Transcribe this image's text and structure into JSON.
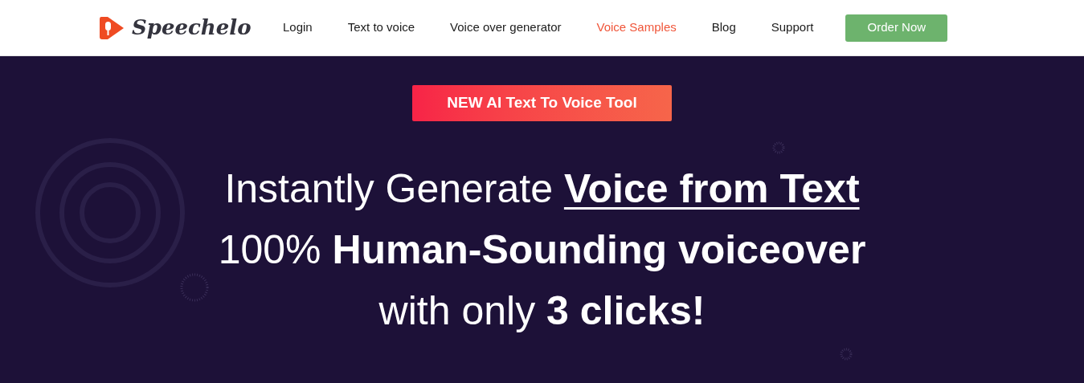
{
  "header": {
    "logo_text": "Speechelo",
    "nav": [
      {
        "label": "Login",
        "selected": false
      },
      {
        "label": "Text to voice",
        "selected": false
      },
      {
        "label": "Voice over generator",
        "selected": false
      },
      {
        "label": "Voice Samples",
        "selected": true
      },
      {
        "label": "Blog",
        "selected": false
      },
      {
        "label": "Support",
        "selected": false
      }
    ],
    "cta": "Order Now"
  },
  "hero": {
    "badge": "NEW AI Text To Voice Tool",
    "headline": [
      [
        {
          "kind": "plain",
          "text": "Instantly Generate "
        },
        {
          "kind": "underlined",
          "text": "Voice from Text"
        }
      ],
      [
        {
          "kind": "plain",
          "text": "100% "
        },
        {
          "kind": "bold",
          "text": "Human-Sounding voiceover"
        }
      ],
      [
        {
          "kind": "plain",
          "text": "with only "
        },
        {
          "kind": "bold",
          "text": "3 clicks!"
        }
      ]
    ]
  }
}
